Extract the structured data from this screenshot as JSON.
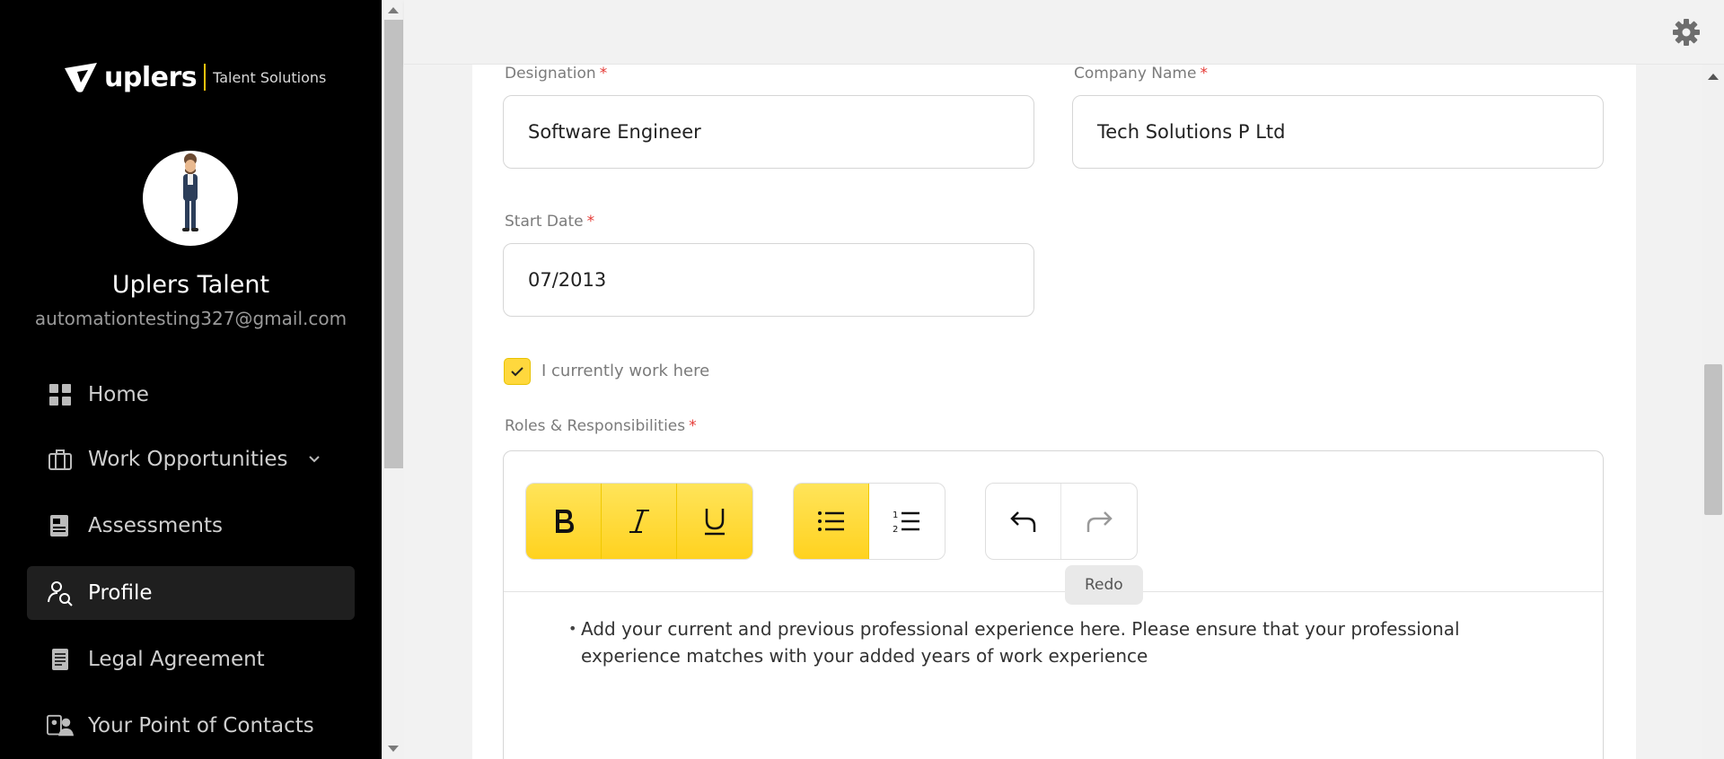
{
  "brand": {
    "name": "uplers",
    "tagline": "Talent Solutions",
    "accent": "#ffd21f"
  },
  "user": {
    "name": "Uplers Talent",
    "email": "automationtesting327@gmail.com"
  },
  "nav": {
    "items": [
      {
        "label": "Home",
        "icon": "grid-icon"
      },
      {
        "label": "Work Opportunities",
        "icon": "briefcase-icon"
      },
      {
        "label": "Assessments",
        "icon": "assessment-icon"
      },
      {
        "label": "Profile",
        "icon": "profile-search-icon",
        "active": true
      },
      {
        "label": "Legal Agreement",
        "icon": "document-icon"
      },
      {
        "label": "Your Point of Contacts",
        "icon": "contacts-icon"
      }
    ]
  },
  "form": {
    "designation": {
      "label": "Designation",
      "value": "Software Engineer"
    },
    "company": {
      "label": "Company Name",
      "value": "Tech Solutions P Ltd"
    },
    "start_date": {
      "label": "Start Date",
      "value": "07/2013"
    },
    "current": {
      "label": "I currently work here",
      "checked": true
    },
    "roles": {
      "label": "Roles & Responsibilities",
      "content": "Add your current and previous professional experience here. Please ensure that your professional experience matches with your added years of work experience"
    },
    "required_mark": "*"
  },
  "toolbar": {
    "buttons": [
      "bold",
      "italic",
      "underline",
      "bullet-list",
      "numbered-list",
      "undo",
      "redo"
    ],
    "tooltip": "Redo"
  }
}
